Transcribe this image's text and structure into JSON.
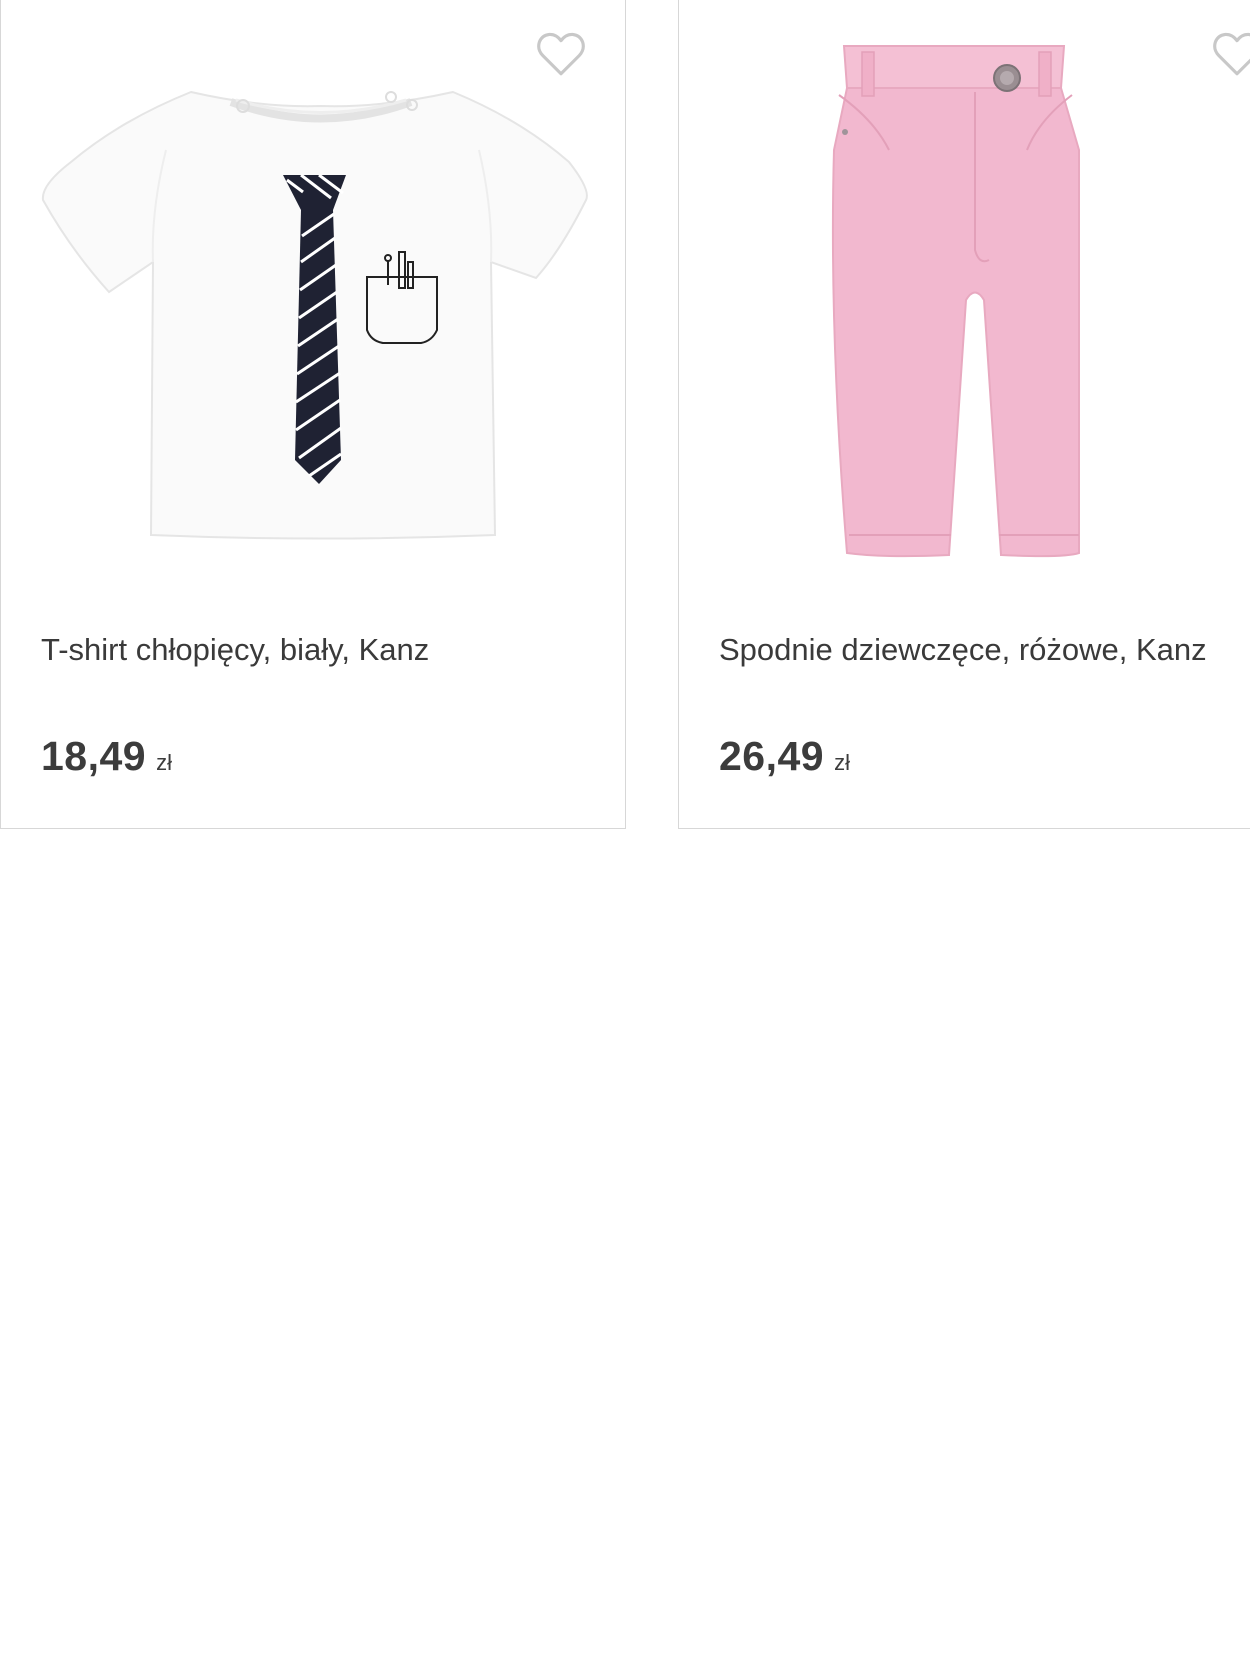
{
  "products": [
    {
      "name": "T-shirt chłopięcy, biały, Kanz",
      "price": "18,49",
      "currency": "zł",
      "image": "white-tshirt-with-tie-print",
      "favorite_icon": "heart-outline-icon"
    },
    {
      "name": "Spodnie dziewczęce, różowe, Kanz",
      "price": "26,49",
      "currency": "zł",
      "image": "pink-trousers",
      "favorite_icon": "heart-outline-icon"
    }
  ],
  "colors": {
    "text": "#3c3c3c",
    "border": "#d7d7d7",
    "heart": "#c8c8c8",
    "tie": "#1f2233",
    "pants_pink": "#f2b8cf"
  }
}
